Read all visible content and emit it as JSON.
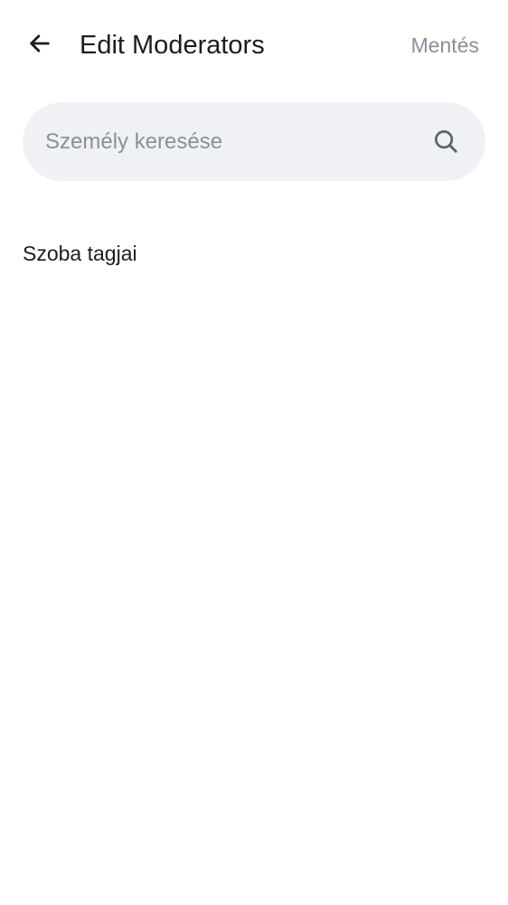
{
  "header": {
    "back_icon": "arrow-left-icon",
    "title": "Edit Moderators",
    "save_label": "Mentés"
  },
  "search": {
    "placeholder": "Személy keresése",
    "value": "",
    "icon": "search-icon"
  },
  "members_section": {
    "title": "Szoba tagjai",
    "items": []
  },
  "colors": {
    "background": "#ffffff",
    "search_background": "#eff1f5",
    "primary_text": "#1b1d21",
    "secondary_text": "#8a8f98"
  }
}
